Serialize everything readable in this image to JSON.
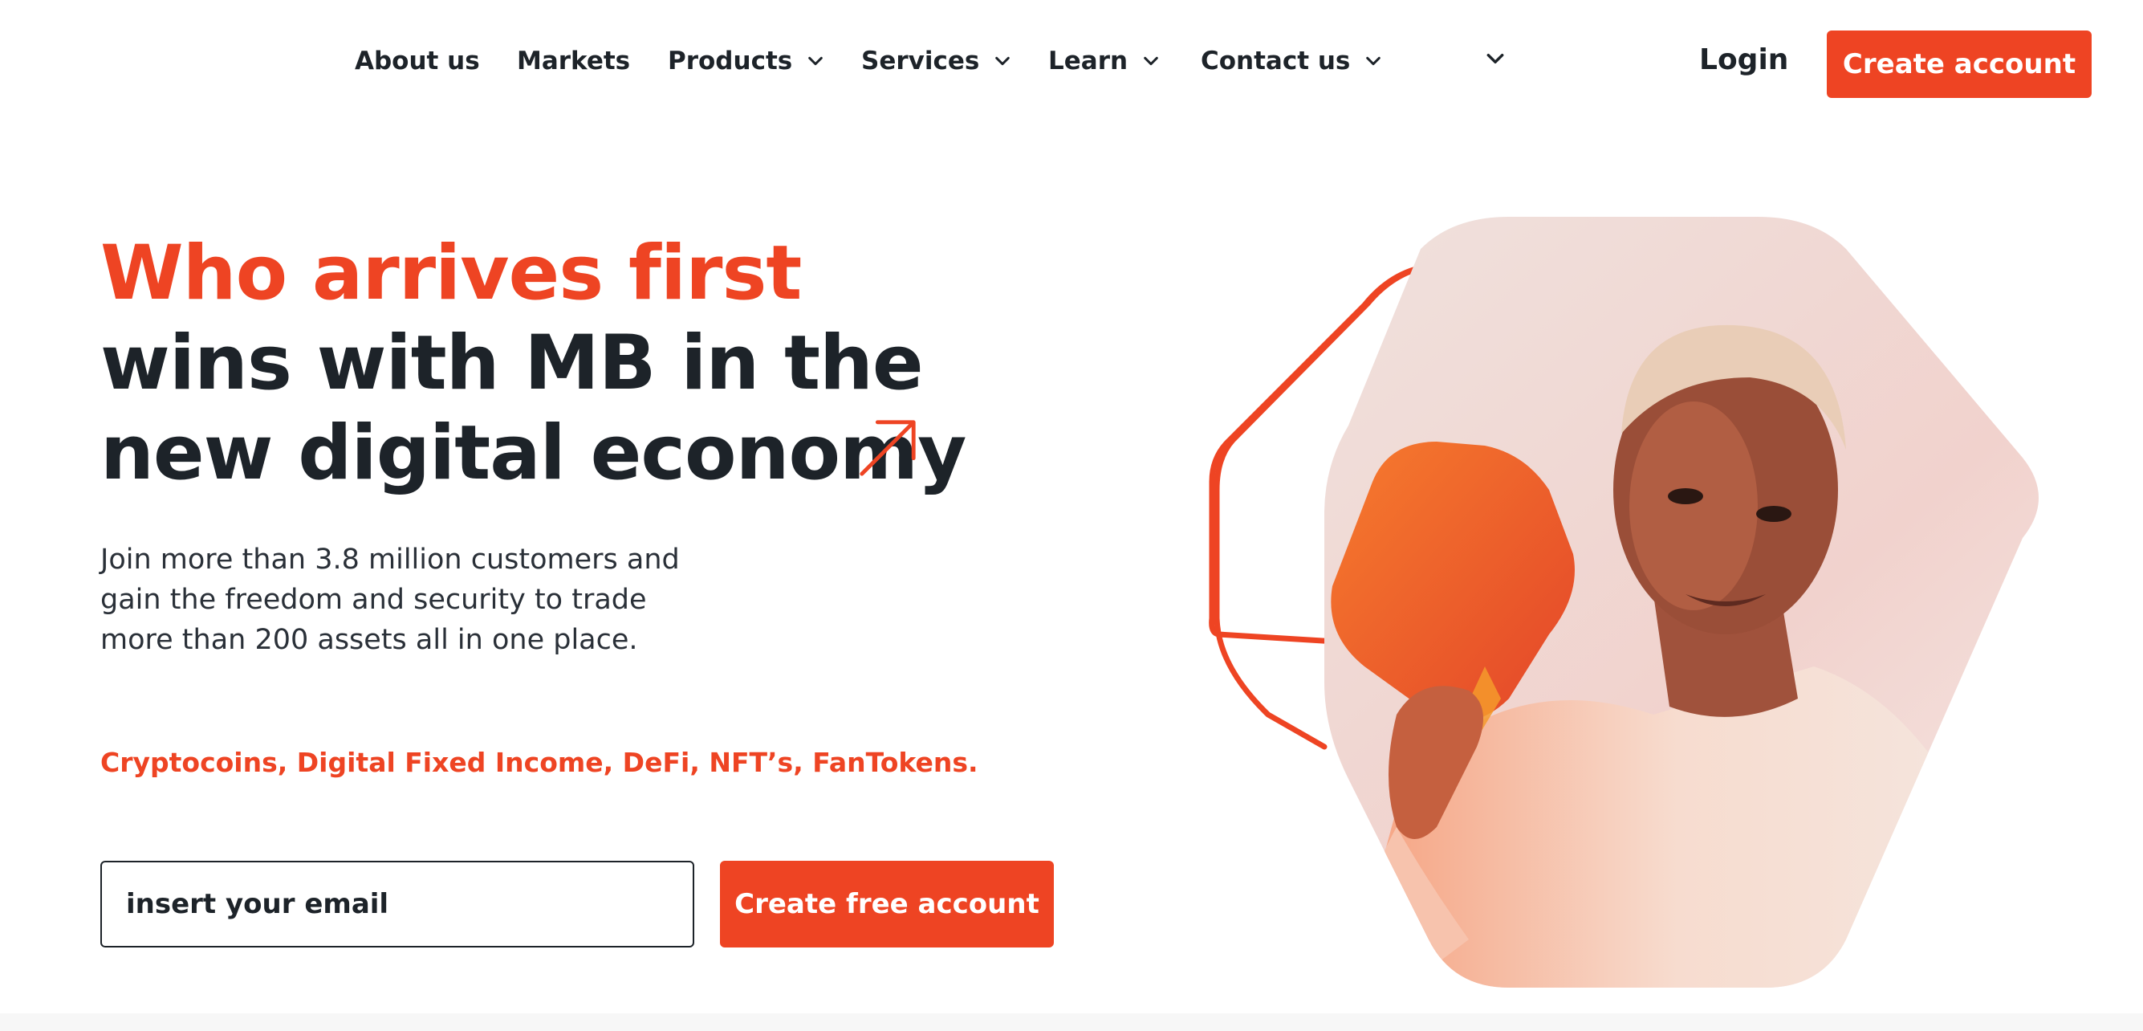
{
  "nav": {
    "items": [
      {
        "label": "About us",
        "dropdown": false
      },
      {
        "label": "Markets",
        "dropdown": false
      },
      {
        "label": "Products",
        "dropdown": true
      },
      {
        "label": "Services",
        "dropdown": true
      },
      {
        "label": "Learn",
        "dropdown": true
      },
      {
        "label": "Contact us",
        "dropdown": true
      }
    ],
    "login_label": "Login",
    "create_account_label": "Create account"
  },
  "hero": {
    "headline_orange": "Who arrives first",
    "headline_line2": "wins with MB in the",
    "headline_line3": "new digital economy",
    "subtext": "Join more than 3.8 million customers and gain the freedom and security to trade more than 200 assets all in one place.",
    "tags": "Cryptocoins, Digital Fixed Income, DeFi, NFT’s, FanTokens.",
    "email_placeholder": "insert your email",
    "cta_label": "Create free account"
  },
  "colors": {
    "accent": "#ee4423",
    "text": "#1d2329"
  },
  "icons": [
    "chevron-down-icon",
    "arrow-up-right-icon"
  ]
}
